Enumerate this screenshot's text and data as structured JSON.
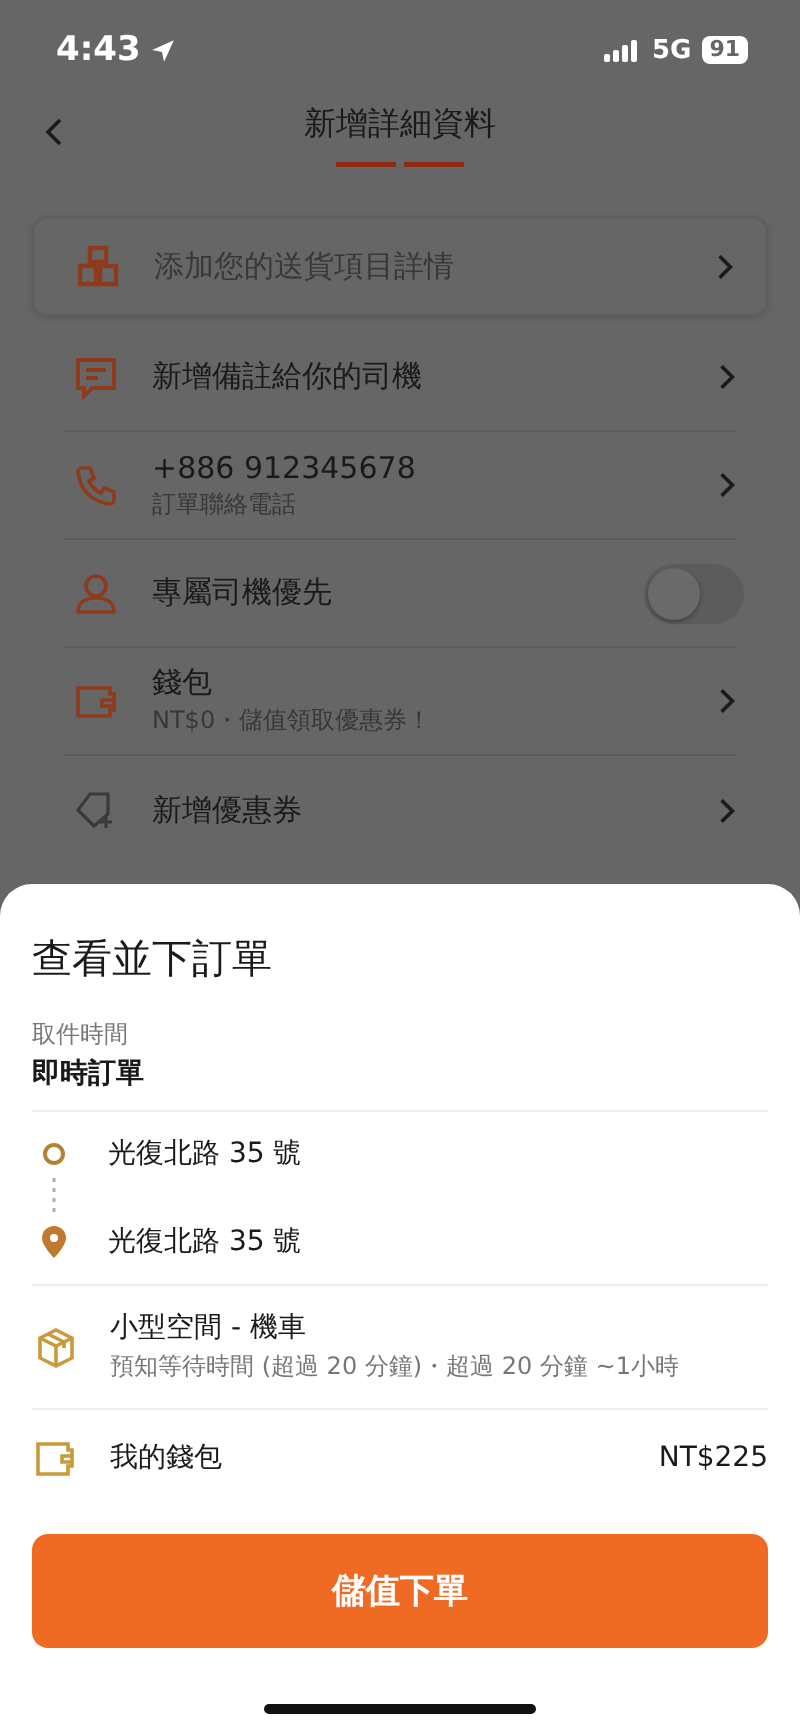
{
  "status_bar": {
    "time": "4:43",
    "network": "5G",
    "battery": "91"
  },
  "header": {
    "title": "新增詳細資料"
  },
  "rows": [
    {
      "kind": "card",
      "label": "添加您的送貨項目詳情"
    },
    {
      "kind": "link",
      "label": "新增備註給你的司機"
    },
    {
      "kind": "link",
      "label": "+886 912345678",
      "sublabel": "訂單聯絡電話"
    },
    {
      "kind": "toggle",
      "label": "專屬司機優先",
      "on": false
    },
    {
      "kind": "link",
      "label": "錢包",
      "sublabel": "NT$0・儲值領取優惠券！"
    },
    {
      "kind": "link",
      "label": "新增優惠券"
    }
  ],
  "sheet": {
    "title": "查看並下訂單",
    "pickup_time": {
      "label": "取件時間",
      "value": "即時訂單"
    },
    "stops": [
      {
        "kind": "pickup",
        "address": "光復北路 35 號"
      },
      {
        "kind": "dropoff",
        "address": "光復北路 35 號"
      }
    ],
    "vehicle": {
      "name": "小型空間 - 機車",
      "note": "預知等待時間 (超過 20 分鐘)・超過 20 分鐘 ~1小時"
    },
    "wallet": {
      "label": "我的錢包",
      "amount": "NT$225"
    },
    "button": "儲值下單"
  }
}
